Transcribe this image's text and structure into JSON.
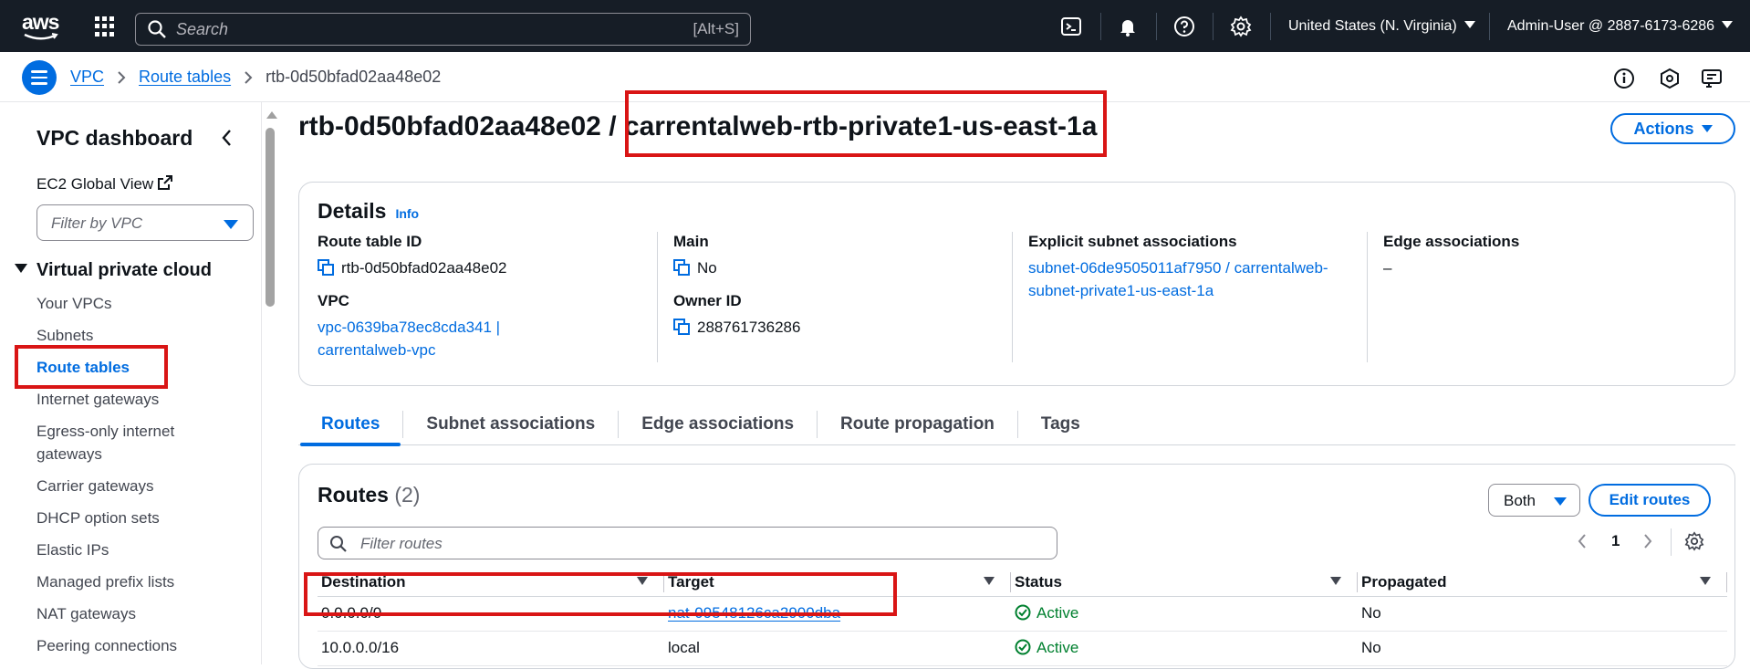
{
  "topbar": {
    "logo_text": "aws",
    "search_placeholder": "Search",
    "search_shortcut": "[Alt+S]",
    "region": "United States (N. Virginia)",
    "account": "Admin-User @ 2887-6173-6286"
  },
  "breadcrumbs": {
    "vpc": "VPC",
    "route_tables": "Route tables",
    "current": "rtb-0d50bfad02aa48e02"
  },
  "sidebar": {
    "title": "VPC dashboard",
    "ec2_global_view": "EC2 Global View",
    "filter_placeholder": "Filter by VPC",
    "section": "Virtual private cloud",
    "items": [
      "Your VPCs",
      "Subnets",
      "Route tables",
      "Internet gateways",
      "Egress-only internet gateways",
      "Carrier gateways",
      "DHCP option sets",
      "Elastic IPs",
      "Managed prefix lists",
      "NAT gateways",
      "Peering connections"
    ]
  },
  "page": {
    "title_id": "rtb-0d50bfad02aa48e02",
    "title_sep": "/",
    "title_name": "carrentalweb-rtb-private1-us-east-1a",
    "actions_label": "Actions"
  },
  "details": {
    "heading": "Details",
    "info": "Info",
    "route_table_id_label": "Route table ID",
    "route_table_id": "rtb-0d50bfad02aa48e02",
    "vpc_label": "VPC",
    "vpc_value": "vpc-0639ba78ec8cda341 | carrentalweb-vpc",
    "main_label": "Main",
    "main_value": "No",
    "owner_label": "Owner ID",
    "owner_value": "288761736286",
    "explicit_label": "Explicit subnet associations",
    "explicit_value": "subnet-06de9505011af7950 / carrentalweb-subnet-private1-us-east-1a",
    "edge_label": "Edge associations",
    "edge_value": "–"
  },
  "tabs": [
    "Routes",
    "Subnet associations",
    "Edge associations",
    "Route propagation",
    "Tags"
  ],
  "routes": {
    "heading": "Routes",
    "count": "(2)",
    "filter_label": "Both",
    "edit_label": "Edit routes",
    "filter_placeholder": "Filter routes",
    "page": "1",
    "columns": [
      "Destination",
      "Target",
      "Status",
      "Propagated"
    ],
    "rows": [
      {
        "destination": "0.0.0.0/0",
        "target": "nat-09548126ca2900dba",
        "status": "Active",
        "propagated": "No"
      },
      {
        "destination": "10.0.0.0/16",
        "target": "local",
        "status": "Active",
        "propagated": "No"
      }
    ]
  },
  "colors": {
    "accent": "#006ce0",
    "topbar_bg": "#161d26",
    "success": "#00802f",
    "highlight": "#d91515"
  },
  "icons": [
    "aws-logo",
    "apps-grid-icon",
    "search-icon",
    "cloudshell-icon",
    "bell-icon",
    "help-icon",
    "gear-icon",
    "menu-icon",
    "info-icon",
    "notification-icon",
    "feedback-icon",
    "collapse-icon",
    "external-link-icon",
    "copy-icon",
    "success-icon"
  ]
}
